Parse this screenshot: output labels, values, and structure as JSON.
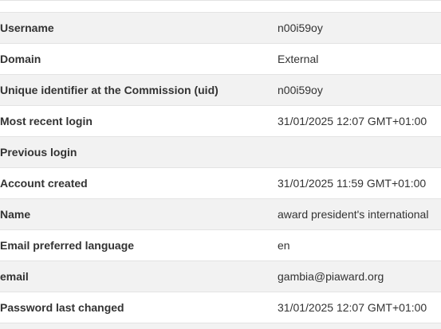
{
  "account_details": {
    "rows": [
      {
        "label": "Username",
        "value": "n00i59oy"
      },
      {
        "label": "Domain",
        "value": "External"
      },
      {
        "label": "Unique identifier at the Commission (uid)",
        "value": "n00i59oy"
      },
      {
        "label": "Most recent login",
        "value": "31/01/2025 12:07 GMT+01:00"
      },
      {
        "label": "Previous login",
        "value": ""
      },
      {
        "label": "Account created",
        "value": "31/01/2025 11:59 GMT+01:00"
      },
      {
        "label": "Name",
        "value": "award president's international"
      },
      {
        "label": "Email preferred language",
        "value": "en"
      },
      {
        "label": "email",
        "value": "gambia@piaward.org"
      },
      {
        "label": "Password last changed",
        "value": "31/01/2025 12:07 GMT+01:00"
      }
    ]
  }
}
